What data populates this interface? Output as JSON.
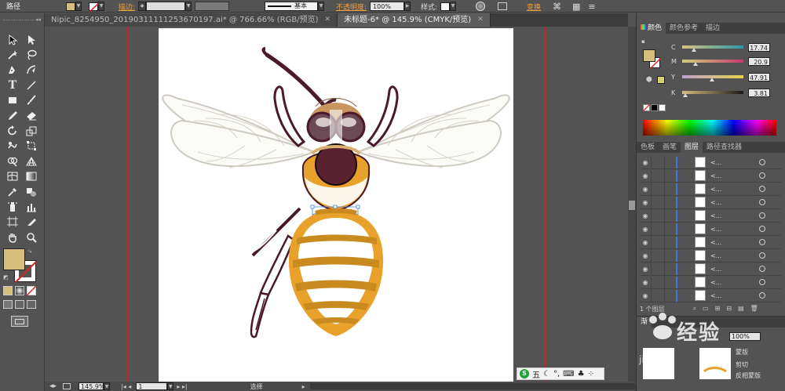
{
  "control_bar": {
    "selection_label": "路径",
    "stroke_label": "描边:",
    "opacity_label": "不透明度:",
    "opacity_value": "100%",
    "style_label": "样式:",
    "brush_label": "基本",
    "transform_label": "变换",
    "fill_color": "#d6bf7a"
  },
  "tabs": [
    {
      "label": "Nipic_8254950_20190311111253670197.ai* @ 766.66% (RGB/预览)",
      "active": false
    },
    {
      "label": "未标题-6* @ 145.9% (CMYK/预览)",
      "active": true
    }
  ],
  "color_panel": {
    "tabs": [
      "颜色",
      "颜色参考",
      "描边"
    ],
    "channels": [
      {
        "label": "C",
        "value": "17.74",
        "pct": 0.18,
        "track": "linear-gradient(90deg,#d8c27e,#2b9aa8)"
      },
      {
        "label": "M",
        "value": "20.9",
        "pct": 0.21,
        "track": "linear-gradient(90deg,#cfd27a,#c83a6e)"
      },
      {
        "label": "Y",
        "value": "47.91",
        "pct": 0.48,
        "track": "linear-gradient(90deg,#c0a0d0,#e8d34a)"
      },
      {
        "label": "K",
        "value": "3.81",
        "pct": 0.04,
        "track": "linear-gradient(90deg,#d6bf7a,#1a1a1a)"
      }
    ],
    "fill_color": "#d6bf7a"
  },
  "layers_panel": {
    "tabs": [
      "色板",
      "画笔",
      "图层",
      "路径查找器"
    ],
    "row_name": "<...",
    "row_count": 11,
    "footer_label": "1 个图层"
  },
  "bottom_panel": {
    "tab_label": "渐",
    "pct_value": "100%",
    "item1": "剪切",
    "item2": "反相蒙版",
    "item3": "蒙版"
  },
  "status_bar": {
    "zoom": "145.9%",
    "artboard_index": "1",
    "tool_label": "选择"
  },
  "ime": {
    "label": "五"
  },
  "watermark": {
    "text": "经验",
    "sub": "jingyan"
  }
}
